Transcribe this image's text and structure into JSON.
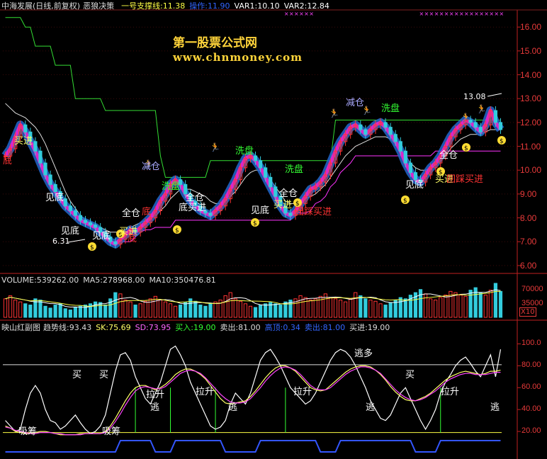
{
  "main_header": {
    "title": "中海发展(日线,前复权)",
    "indicator": "恶狼决策",
    "support": "一号支撑线:11.38",
    "op": "操作:11.90",
    "var1": "VAR1:10.10",
    "var2": "VAR2:12.84"
  },
  "watermark": {
    "line1": "第一股票公式网",
    "line2": "www.chnmoney.com"
  },
  "price_axis": {
    "labels": [
      "16.00",
      "15.00",
      "14.00",
      "13.00",
      "12.00",
      "11.00",
      "10.00",
      "9.00",
      "8.00",
      "7.00",
      "6.00"
    ],
    "low_marker": "6.31",
    "high_marker": "13.08"
  },
  "price_annotations": [
    {
      "text": "买进",
      "color": "#ffff66"
    },
    {
      "text": "底",
      "color": "#ff3333"
    },
    {
      "text": "见底",
      "color": "#ffffff"
    },
    {
      "text": "见底",
      "color": "#ffffff"
    },
    {
      "text": "见底",
      "color": "#ffffff"
    },
    {
      "text": "买进",
      "color": "#ffff66"
    },
    {
      "text": "底",
      "color": "#ff3333"
    },
    {
      "text": "全仓",
      "color": "#ffffff"
    },
    {
      "text": "减仓",
      "color": "#aaaaff"
    },
    {
      "text": "洗盘",
      "color": "#33ff33"
    },
    {
      "text": "底",
      "color": "#ff3333"
    },
    {
      "text": "全仓",
      "color": "#ffffff"
    },
    {
      "text": "底买进",
      "color": "#ffffff"
    },
    {
      "text": "洗盘",
      "color": "#33ff33"
    },
    {
      "text": "见底",
      "color": "#ffffff"
    },
    {
      "text": "洗盘",
      "color": "#33ff33"
    },
    {
      "text": "全仓",
      "color": "#ffffff"
    },
    {
      "text": "买进",
      "color": "#ffff66"
    },
    {
      "text": "回踩买进",
      "color": "#ff3333"
    },
    {
      "text": "减仓",
      "color": "#aaaaff"
    },
    {
      "text": "洗盘",
      "color": "#33ff33"
    },
    {
      "text": "全仓",
      "color": "#ffffff"
    },
    {
      "text": "见底",
      "color": "#ffffff"
    },
    {
      "text": "买进",
      "color": "#ffff66"
    },
    {
      "text": "回踩买进",
      "color": "#ff3333"
    }
  ],
  "volume_header": {
    "vol": "VOLUME:539262.00",
    "ma5": "MA5:278968.00",
    "ma10": "MA10:350476.81"
  },
  "volume_axis": {
    "labels": [
      "70000",
      "35000"
    ],
    "unit": "X10"
  },
  "osc_header": {
    "title": "映山红副图",
    "trend": "趋势线:93.43",
    "sk": "SK:75.69",
    "sd": "SD:73.95",
    "buy": "买入:19.00",
    "sell": "卖出:81.00",
    "peak": "高顶:0.34",
    "out": "卖出:81.00",
    "in": "买进:19.00"
  },
  "osc_axis": {
    "labels": [
      "100.0",
      "80.00",
      "60.00",
      "40.00",
      "20.00"
    ]
  },
  "osc_annotations": [
    {
      "text": "吸筹",
      "color": "#ffffff"
    },
    {
      "text": "买",
      "color": "#ffffff"
    },
    {
      "text": "买",
      "color": "#ffffff"
    },
    {
      "text": "吸筹",
      "color": "#ffffff"
    },
    {
      "text": "拉升",
      "color": "#ffffff"
    },
    {
      "text": "逃",
      "color": "#ffffff"
    },
    {
      "text": "拉升",
      "color": "#ffffff"
    },
    {
      "text": "逃",
      "color": "#ffffff"
    },
    {
      "text": "拉升",
      "color": "#ffffff"
    },
    {
      "text": "逃多",
      "color": "#ffffff"
    },
    {
      "text": "逃",
      "color": "#ffffff"
    },
    {
      "text": "买",
      "color": "#ffffff"
    },
    {
      "text": "拉升",
      "color": "#ffffff"
    },
    {
      "text": "逃",
      "color": "#ffffff"
    }
  ],
  "chart_data": {
    "type": "line",
    "title": "中海发展(日线,前复权)",
    "ylim": [
      5.7,
      16.6
    ],
    "close": [
      10.6,
      10.9,
      11.4,
      11.9,
      11.6,
      11.2,
      10.8,
      10.3,
      9.8,
      9.4,
      9.1,
      8.8,
      8.5,
      8.3,
      8.1,
      7.9,
      7.8,
      7.7,
      7.6,
      7.4,
      7.2,
      7.0,
      6.9,
      7.1,
      7.3,
      7.5,
      7.4,
      7.6,
      7.8,
      8.0,
      8.3,
      8.7,
      9.0,
      9.4,
      9.6,
      9.4,
      9.0,
      8.7,
      8.5,
      8.3,
      8.2,
      8.1,
      8.3,
      8.5,
      8.8,
      9.2,
      9.6,
      10.1,
      10.5,
      10.6,
      10.4,
      10.1,
      9.7,
      9.3,
      8.9,
      8.5,
      8.2,
      8.1,
      8.3,
      8.6,
      8.9,
      9.2,
      9.3,
      9.5,
      9.8,
      10.3,
      10.8,
      11.2,
      11.5,
      11.8,
      11.9,
      11.7,
      11.5,
      11.7,
      11.9,
      12.0,
      11.8,
      11.5,
      11.2,
      10.8,
      10.3,
      9.9,
      9.6,
      9.5,
      9.8,
      10.1,
      10.3,
      10.6,
      11.0,
      11.4,
      11.7,
      11.9,
      12.1,
      12.0,
      11.8,
      11.6,
      11.9,
      12.5,
      12.0,
      11.7
    ],
    "support_line": [
      16.4,
      16.4,
      16.4,
      16.4,
      16.0,
      16.0,
      15.2,
      15.2,
      15.2,
      15.2,
      14.4,
      14.4,
      14.4,
      14.4,
      13.0,
      13.0,
      13.0,
      13.0,
      13.0,
      13.0,
      12.5,
      12.5,
      12.5,
      12.5,
      12.5,
      12.5,
      12.5,
      12.5,
      12.5,
      12.5,
      12.5,
      10.6,
      9.7,
      9.7,
      9.7,
      9.7,
      9.7,
      9.7,
      9.7,
      9.7,
      9.7,
      10.4,
      10.4,
      10.4,
      10.4,
      10.4,
      10.4,
      10.4,
      10.4,
      10.4,
      10.4,
      10.4,
      10.4,
      10.4,
      10.4,
      10.4,
      10.4,
      10.4,
      10.4,
      10.4,
      10.4,
      10.4,
      10.4,
      10.4,
      10.4,
      10.4,
      12.1,
      12.1,
      12.1,
      12.1,
      12.1,
      12.1,
      12.1,
      12.1,
      12.1,
      12.1,
      12.1,
      12.1,
      12.1,
      12.1,
      12.1,
      12.1,
      12.1,
      12.1,
      12.1,
      12.1,
      12.1,
      12.1,
      12.1,
      12.1,
      12.1,
      12.1,
      12.1,
      12.1,
      12.1,
      12.1,
      12.1,
      12.1,
      12.1,
      12.1
    ],
    "ma_white": [
      12.8,
      12.6,
      12.4,
      12.3,
      12.2,
      12.0,
      11.8,
      11.5,
      11.1,
      10.6,
      10.1,
      9.6,
      9.1,
      8.7,
      8.4,
      8.1,
      7.9,
      7.8,
      7.7,
      7.6,
      7.5,
      7.4,
      7.4,
      7.4,
      7.5,
      7.6,
      7.7,
      7.8,
      7.9,
      8.0,
      8.1,
      8.3,
      8.5,
      8.8,
      9.0,
      9.2,
      9.2,
      9.2,
      9.1,
      9.0,
      8.9,
      8.7,
      8.6,
      8.6,
      8.7,
      8.9,
      9.1,
      9.4,
      9.7,
      9.9,
      10.0,
      10.0,
      9.9,
      9.6,
      9.3,
      9.0,
      8.7,
      8.6,
      8.6,
      8.7,
      8.8,
      8.9,
      9.0,
      9.2,
      9.4,
      9.7,
      10.0,
      10.3,
      10.6,
      10.8,
      11.0,
      11.1,
      11.2,
      11.3,
      11.4,
      11.4,
      11.4,
      11.3,
      11.1,
      10.9,
      10.6,
      10.3,
      10.1,
      10.0,
      10.0,
      10.1,
      10.2,
      10.4,
      10.6,
      10.9,
      11.1,
      11.3,
      11.4,
      11.5,
      11.5,
      11.5,
      11.6,
      11.7,
      11.7,
      11.7
    ],
    "base_magenta": [
      null,
      null,
      null,
      null,
      null,
      null,
      null,
      null,
      null,
      null,
      null,
      null,
      null,
      null,
      null,
      null,
      null,
      null,
      null,
      null,
      null,
      7.0,
      7.0,
      7.0,
      7.0,
      7.0,
      7.2,
      7.4,
      7.5,
      7.5,
      7.6,
      7.6,
      7.6,
      7.6,
      7.9,
      7.9,
      7.9,
      7.9,
      7.9,
      7.9,
      7.9,
      7.9,
      7.9,
      7.9,
      7.9,
      7.9,
      7.9,
      7.9,
      7.9,
      7.9,
      7.9,
      7.9,
      7.9,
      7.9,
      7.9,
      7.9,
      7.9,
      7.9,
      8.2,
      8.2,
      8.2,
      8.3,
      8.6,
      8.7,
      8.9,
      9.3,
      9.5,
      9.9,
      10.1,
      10.3,
      10.6,
      10.6,
      10.6,
      10.6,
      10.6,
      10.6,
      10.6,
      10.6,
      10.6,
      10.6,
      10.6,
      10.6,
      10.6,
      10.6,
      10.6,
      10.6,
      10.8,
      10.8,
      10.8,
      10.8,
      10.8,
      10.8,
      10.8,
      10.8,
      10.8,
      10.8,
      10.8,
      10.8,
      10.8,
      10.8
    ],
    "volume": [
      30,
      35,
      28,
      25,
      22,
      20,
      30,
      28,
      18,
      15,
      20,
      22,
      14,
      12,
      16,
      18,
      20,
      22,
      25,
      24,
      20,
      30,
      40,
      38,
      28,
      25,
      20,
      22,
      26,
      30,
      34,
      28,
      25,
      22,
      18,
      20,
      24,
      30,
      26,
      20,
      18,
      22,
      25,
      28,
      35,
      40,
      30,
      26,
      22,
      18,
      16,
      20,
      22,
      24,
      22,
      20,
      25,
      28,
      30,
      35,
      32,
      28,
      30,
      34,
      38,
      32,
      30,
      28,
      25,
      30,
      40,
      35,
      30,
      28,
      26,
      22,
      20,
      24,
      28,
      32,
      30,
      36,
      40,
      45,
      38,
      30,
      28,
      32,
      36,
      42,
      40,
      36,
      34,
      44,
      48,
      40,
      36,
      44,
      55,
      42
    ],
    "osc_white": [
      30,
      25,
      20,
      22,
      40,
      55,
      62,
      55,
      40,
      30,
      28,
      22,
      25,
      30,
      35,
      28,
      22,
      18,
      20,
      25,
      35,
      55,
      75,
      90,
      92,
      85,
      70,
      60,
      50,
      45,
      55,
      65,
      80,
      95,
      98,
      90,
      80,
      65,
      55,
      45,
      35,
      25,
      22,
      24,
      30,
      45,
      55,
      50,
      45,
      55,
      70,
      85,
      92,
      95,
      88,
      80,
      70,
      60,
      55,
      50,
      45,
      48,
      55,
      65,
      75,
      85,
      92,
      95,
      93,
      88,
      80,
      70,
      60,
      48,
      40,
      32,
      30,
      35,
      45,
      55,
      60,
      50,
      40,
      30,
      22,
      30,
      40,
      55,
      65,
      72,
      80,
      85,
      88,
      82,
      75,
      70,
      80,
      90,
      70,
      95
    ],
    "osc_sk": [
      25,
      23,
      20,
      19,
      18,
      18,
      19,
      20,
      20,
      19,
      18,
      17,
      17,
      17,
      17,
      18,
      18,
      18,
      18,
      18,
      20,
      25,
      32,
      40,
      48,
      55,
      60,
      62,
      62,
      60,
      58,
      60,
      63,
      67,
      72,
      75,
      77,
      77,
      75,
      72,
      68,
      62,
      56,
      50,
      46,
      45,
      46,
      47,
      48,
      52,
      57,
      63,
      69,
      74,
      78,
      80,
      80,
      78,
      75,
      70,
      65,
      60,
      58,
      57,
      58,
      62,
      66,
      70,
      74,
      77,
      79,
      80,
      80,
      79,
      76,
      72,
      67,
      61,
      56,
      52,
      49,
      48,
      48,
      50,
      52,
      55,
      59,
      63,
      67,
      70,
      72,
      74,
      75,
      74,
      73,
      72,
      73,
      75,
      75,
      76
    ],
    "osc_sd": [
      24,
      23,
      21,
      20,
      19,
      18,
      18,
      19,
      19,
      19,
      18,
      18,
      17,
      17,
      17,
      17,
      18,
      18,
      18,
      18,
      19,
      23,
      29,
      36,
      44,
      51,
      57,
      60,
      61,
      60,
      59,
      59,
      61,
      65,
      69,
      73,
      75,
      76,
      75,
      73,
      69,
      64,
      59,
      54,
      50,
      47,
      46,
      46,
      47,
      50,
      55,
      60,
      66,
      71,
      75,
      78,
      79,
      78,
      76,
      72,
      67,
      62,
      59,
      58,
      58,
      60,
      64,
      68,
      72,
      75,
      77,
      79,
      79,
      78,
      76,
      73,
      68,
      63,
      58,
      54,
      51,
      49,
      48,
      49,
      51,
      54,
      57,
      61,
      65,
      68,
      70,
      72,
      73,
      73,
      72,
      72,
      72,
      73,
      74,
      74
    ],
    "osc_blue_step": [
      0,
      0,
      0,
      0,
      0,
      0,
      0,
      0,
      0,
      0,
      0,
      0,
      0,
      0,
      0,
      0,
      0,
      0,
      0,
      0,
      0,
      0,
      0,
      1,
      1,
      1,
      1,
      1,
      1,
      1,
      0,
      0,
      0,
      0,
      1,
      1,
      1,
      1,
      1,
      1,
      1,
      1,
      1,
      1,
      0,
      0,
      0,
      0,
      0,
      0,
      0,
      1,
      1,
      1,
      1,
      1,
      1,
      1,
      1,
      1,
      1,
      1,
      1,
      0,
      0,
      0,
      0,
      1,
      1,
      1,
      1,
      1,
      1,
      1,
      1,
      1,
      1,
      1,
      1,
      1,
      1,
      1,
      0,
      0,
      0,
      0,
      0,
      1,
      1,
      1,
      1,
      1,
      1,
      1,
      1,
      1,
      1,
      1,
      1,
      1
    ],
    "buy_level": 19.0,
    "sell_level": 81.0,
    "osc_ylim": [
      0,
      110
    ]
  },
  "colors": {
    "up": "#ff3333",
    "down": "#33ccdd",
    "support": "#33dd33",
    "magenta": "#ff33ff",
    "white": "#e0e0e0",
    "yellow": "#ffff44",
    "blue": "#3355ff"
  }
}
